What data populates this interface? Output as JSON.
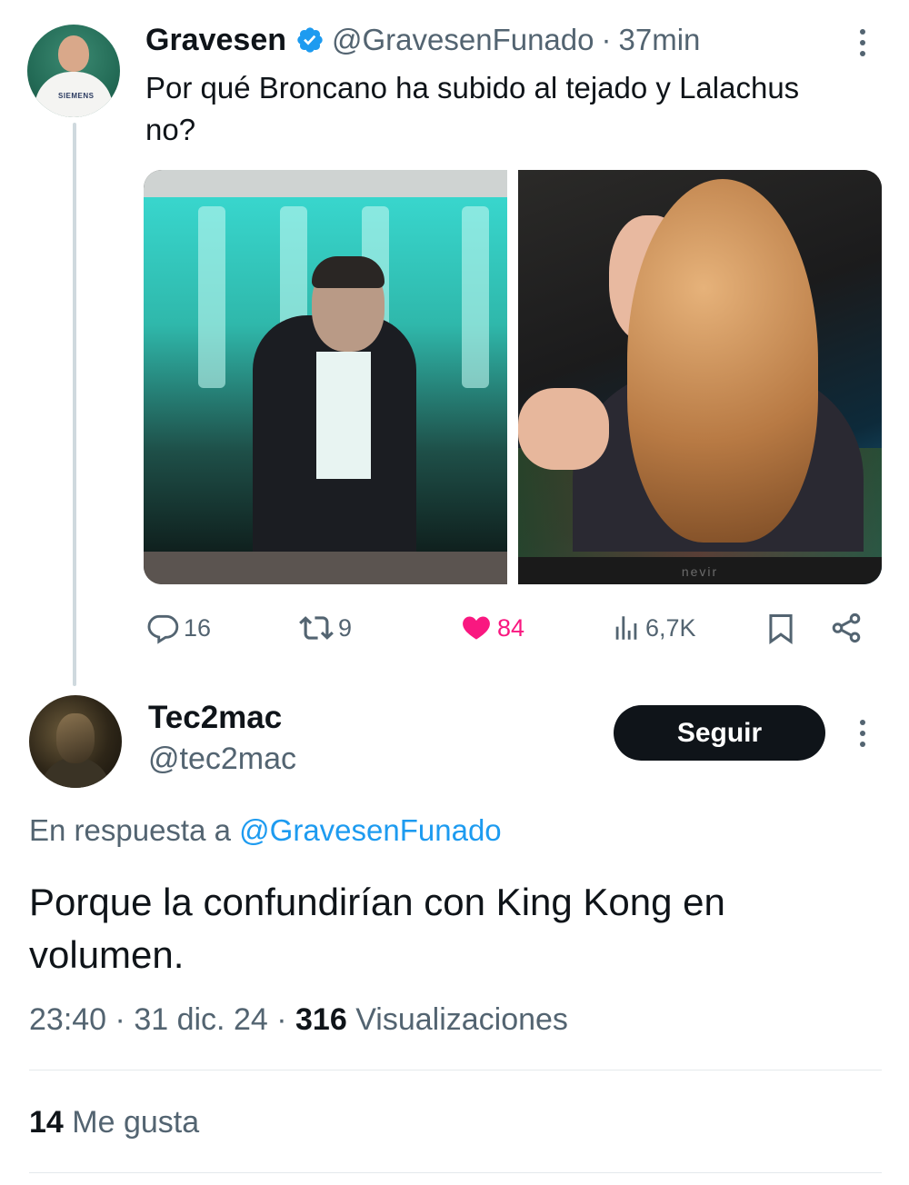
{
  "tweet1": {
    "author_name": "Gravesen",
    "author_handle": "@GravesenFunado",
    "separator": "·",
    "time": "37min",
    "text": "Por qué Broncano ha subido al tejado y Lalachus no?",
    "avatar_logo": "SIEMENS",
    "tv_brand": "nevir",
    "actions": {
      "replies": "16",
      "retweets": "9",
      "likes": "84",
      "views": "6,7K"
    }
  },
  "tweet2": {
    "author_name": "Tec2mac",
    "author_handle": "@tec2mac",
    "follow_label": "Seguir",
    "reply_prefix": "En respuesta a",
    "reply_mention": "@GravesenFunado",
    "text": "Porque la confundirían con King Kong en volumen.",
    "time": "23:40",
    "date": "31 dic. 24",
    "separator": "·",
    "views_count": "316",
    "views_label": "Visualizaciones",
    "likes_count": "14",
    "likes_label": "Me gusta"
  },
  "colors": {
    "text_primary": "#0f1419",
    "text_secondary": "#536471",
    "link": "#1d9bf0",
    "like": "#f91880",
    "verified": "#1d9bf0"
  },
  "icons": [
    "verified-badge-icon",
    "more-icon",
    "reply-icon",
    "retweet-icon",
    "heart-icon",
    "views-icon",
    "bookmark-icon",
    "share-icon"
  ]
}
